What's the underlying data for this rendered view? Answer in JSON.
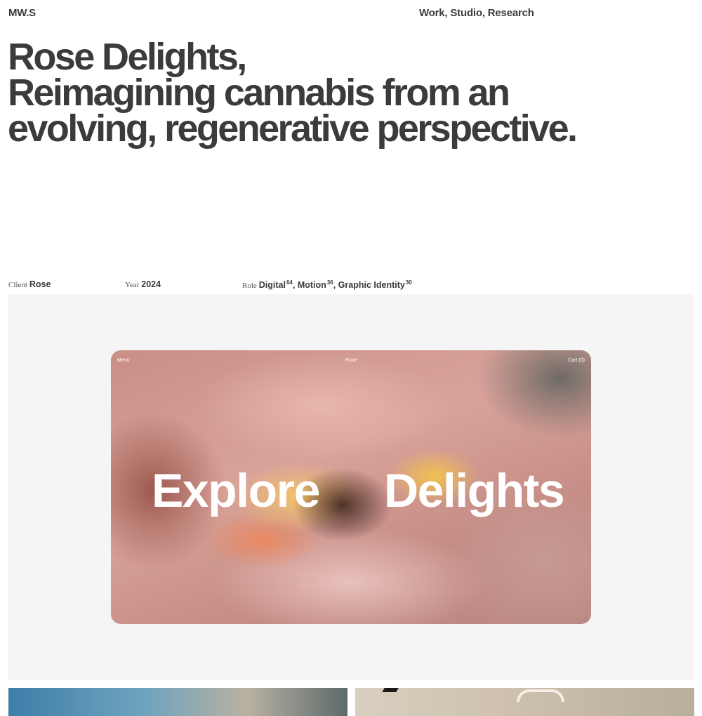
{
  "header": {
    "logo": "MW.S",
    "nav": [
      "Work",
      "Studio",
      "Research"
    ],
    "separator": ", "
  },
  "headline": {
    "line1": "Rose Delights,",
    "line2": "Reimagining cannabis from an",
    "line3": "evolving, regenerative perspective."
  },
  "meta": {
    "client": {
      "label": "Client",
      "value": "Rose"
    },
    "year": {
      "label": "Year",
      "value": "2024"
    },
    "role": {
      "label": "Role",
      "items": [
        {
          "name": "Digital",
          "count": "64"
        },
        {
          "name": "Motion",
          "count": "36"
        },
        {
          "name": "Graphic Identity",
          "count": "30"
        }
      ]
    }
  },
  "hero": {
    "nav_menu": "Menu",
    "nav_brand": "Rose",
    "nav_cart": "Cart (0)",
    "title_left": "Explore",
    "title_right": "Delights"
  },
  "colors": {
    "text": "#3d3d3d",
    "panel": "#f5f5f5",
    "overlay_text": "#ffffff"
  }
}
